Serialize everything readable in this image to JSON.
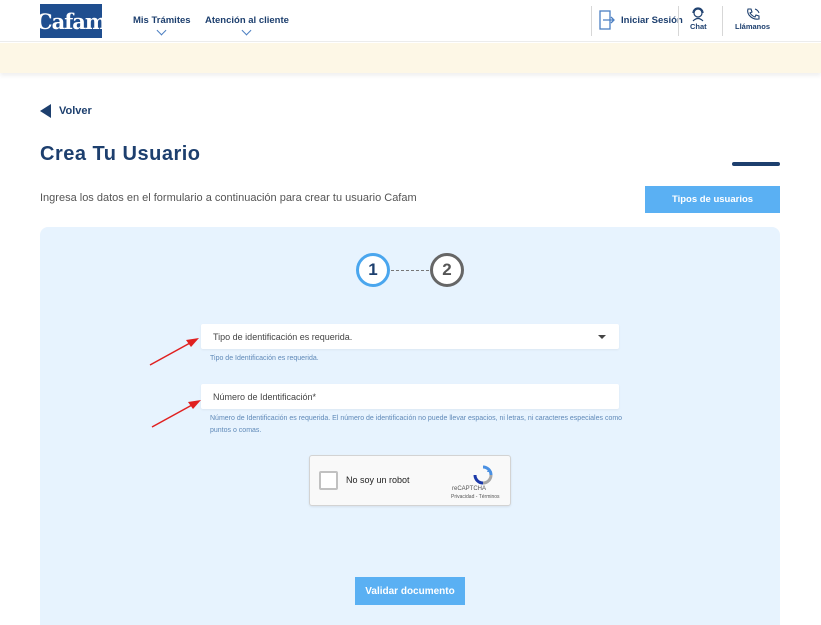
{
  "header": {
    "logo": "Cafam",
    "nav": [
      {
        "label": "Mis Trámites"
      },
      {
        "label": "Atención al cliente"
      }
    ],
    "login_label": "Iniciar Sesión",
    "chat_label": "Chat",
    "call_label": "Llámanos"
  },
  "page": {
    "back_label": "Volver",
    "title": "Crea Tu Usuario",
    "intro": "Ingresa los datos en el formulario a continuación para crear tu usuario Cafam",
    "types_button": "Tipos de usuarios"
  },
  "stepper": {
    "steps": [
      "1",
      "2"
    ],
    "active": 1
  },
  "form": {
    "id_type": {
      "selected": "Tipo de identificación es requerida.",
      "error": "Tipo de Identificación es requerida."
    },
    "id_number": {
      "placeholder": "Número de Identificación*",
      "error": "Número de Identificación es requerida. El número de identificación no puede llevar espacios, ni letras, ni caracteres especiales como puntos o comas."
    },
    "captcha": {
      "label": "No soy un robot",
      "brand": "reCAPTCHA",
      "terms": "Privacidad - Términos"
    },
    "submit": "Validar documento"
  },
  "colors": {
    "brand_blue": "#1f4e8f",
    "accent_blue": "#5ab0f3",
    "panel_bg": "#e7f3fe",
    "banner_bg": "#fdf7e6",
    "annotation_red": "#e02020"
  },
  "icons": [
    "chevron-down-icon",
    "login-door-icon",
    "chat-agent-icon",
    "phone-icon",
    "back-triangle-icon",
    "dropdown-caret-icon",
    "recaptcha-icon"
  ]
}
